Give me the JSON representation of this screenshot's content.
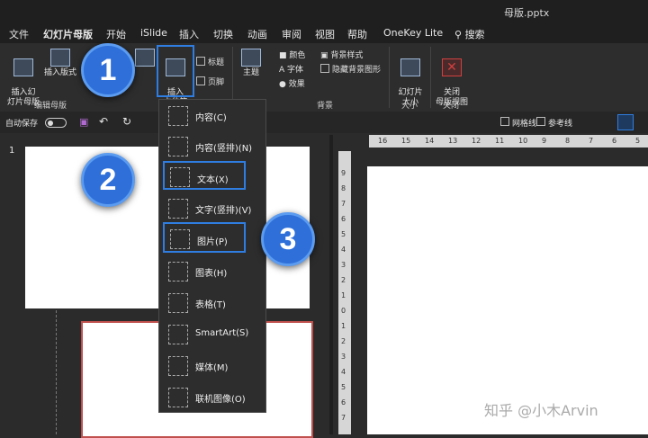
{
  "window": {
    "title": "母版.pptx"
  },
  "tabs": [
    "文件",
    "幻灯片母版",
    "开始",
    "iSlide",
    "插入",
    "切换",
    "动画",
    "审阅",
    "视图",
    "帮助",
    "OneKey Lite"
  ],
  "search": {
    "label": "搜索"
  },
  "ribbon": {
    "insert_master": "插入幻\n灯片母版",
    "insert_layout": "插入版式",
    "insert_placeholder": "插入\n占位符",
    "title_check": "标题",
    "footer_check": "页脚",
    "theme": "主题",
    "colors": "颜色",
    "fonts": "字体",
    "effects": "效果",
    "bg_styles": "背景样式",
    "hide_bg": "隐藏背景图形",
    "slide_size": "幻灯片\n大小",
    "close_master": "关闭\n母版视图",
    "group_edit_master": "编辑母版",
    "group_background": "背景",
    "group_size": "大小",
    "group_close": "关闭"
  },
  "qat": {
    "autosave": "自动保存",
    "gridlines": "网格线",
    "guides": "参考线"
  },
  "menu": {
    "items": [
      "内容(C)",
      "内容(竖排)(N)",
      "文本(X)",
      "文字(竖排)(V)",
      "图片(P)",
      "图表(H)",
      "表格(T)",
      "SmartArt(S)",
      "媒体(M)",
      "联机图像(O)"
    ]
  },
  "thumbnails": {
    "slide_number": "1"
  },
  "rulers": {
    "h": [
      "16",
      "15",
      "14",
      "13",
      "12",
      "11",
      "10",
      "9",
      "8",
      "7",
      "6",
      "5"
    ],
    "v": [
      "9",
      "8",
      "7",
      "6",
      "5",
      "4",
      "3",
      "2",
      "1",
      "0",
      "1",
      "2",
      "3",
      "4",
      "5",
      "6",
      "7"
    ]
  },
  "badges": [
    "1",
    "2",
    "3"
  ],
  "watermark": "知乎 @小木Arvin",
  "colors": {
    "highlight": "#2f7de1",
    "badge": "#2e6fd9"
  }
}
